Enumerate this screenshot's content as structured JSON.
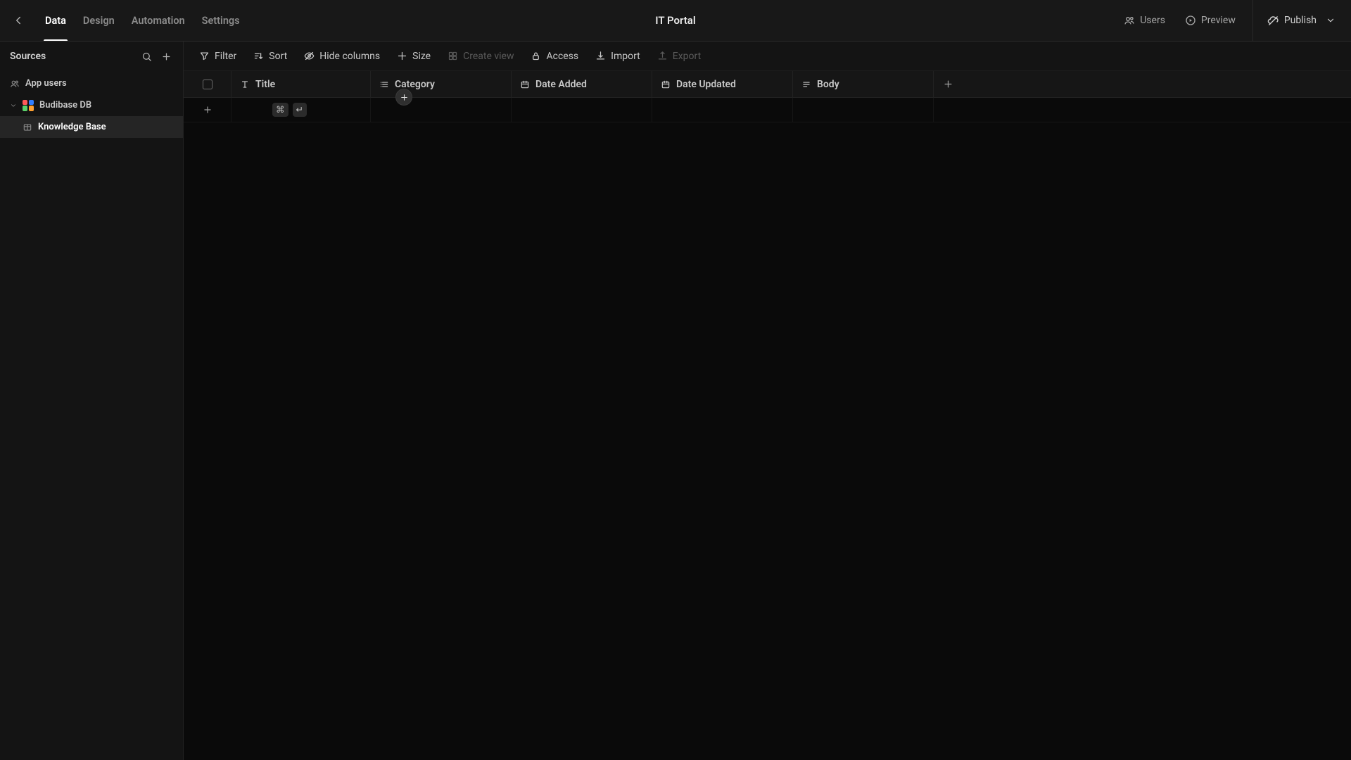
{
  "header": {
    "app_title": "IT Portal",
    "tabs": [
      {
        "label": "Data",
        "active": true
      },
      {
        "label": "Design",
        "active": false
      },
      {
        "label": "Automation",
        "active": false
      },
      {
        "label": "Settings",
        "active": false
      }
    ],
    "users_label": "Users",
    "preview_label": "Preview",
    "publish_label": "Publish"
  },
  "sidebar": {
    "title": "Sources",
    "items": [
      {
        "label": "App users",
        "icon": "people-icon",
        "level": 0,
        "selected": false,
        "expandable": false
      },
      {
        "label": "Budibase DB",
        "icon": "budibase-logo",
        "level": 1,
        "selected": false,
        "expandable": true,
        "expanded": true
      },
      {
        "label": "Knowledge Base",
        "icon": "table-icon",
        "level": 2,
        "selected": true,
        "expandable": false
      }
    ]
  },
  "toolbar": {
    "filter": "Filter",
    "sort": "Sort",
    "hide_columns": "Hide columns",
    "size": "Size",
    "create_view": "Create view",
    "access": "Access",
    "import": "Import",
    "export": "Export"
  },
  "columns": [
    {
      "label": "Title",
      "icon": "text-icon"
    },
    {
      "label": "Category",
      "icon": "list-icon"
    },
    {
      "label": "Date Added",
      "icon": "calendar-icon"
    },
    {
      "label": "Date Updated",
      "icon": "calendar-icon"
    },
    {
      "label": "Body",
      "icon": "longtext-icon"
    }
  ],
  "row_hints": {
    "cmd": "⌘",
    "enter": "↵"
  }
}
